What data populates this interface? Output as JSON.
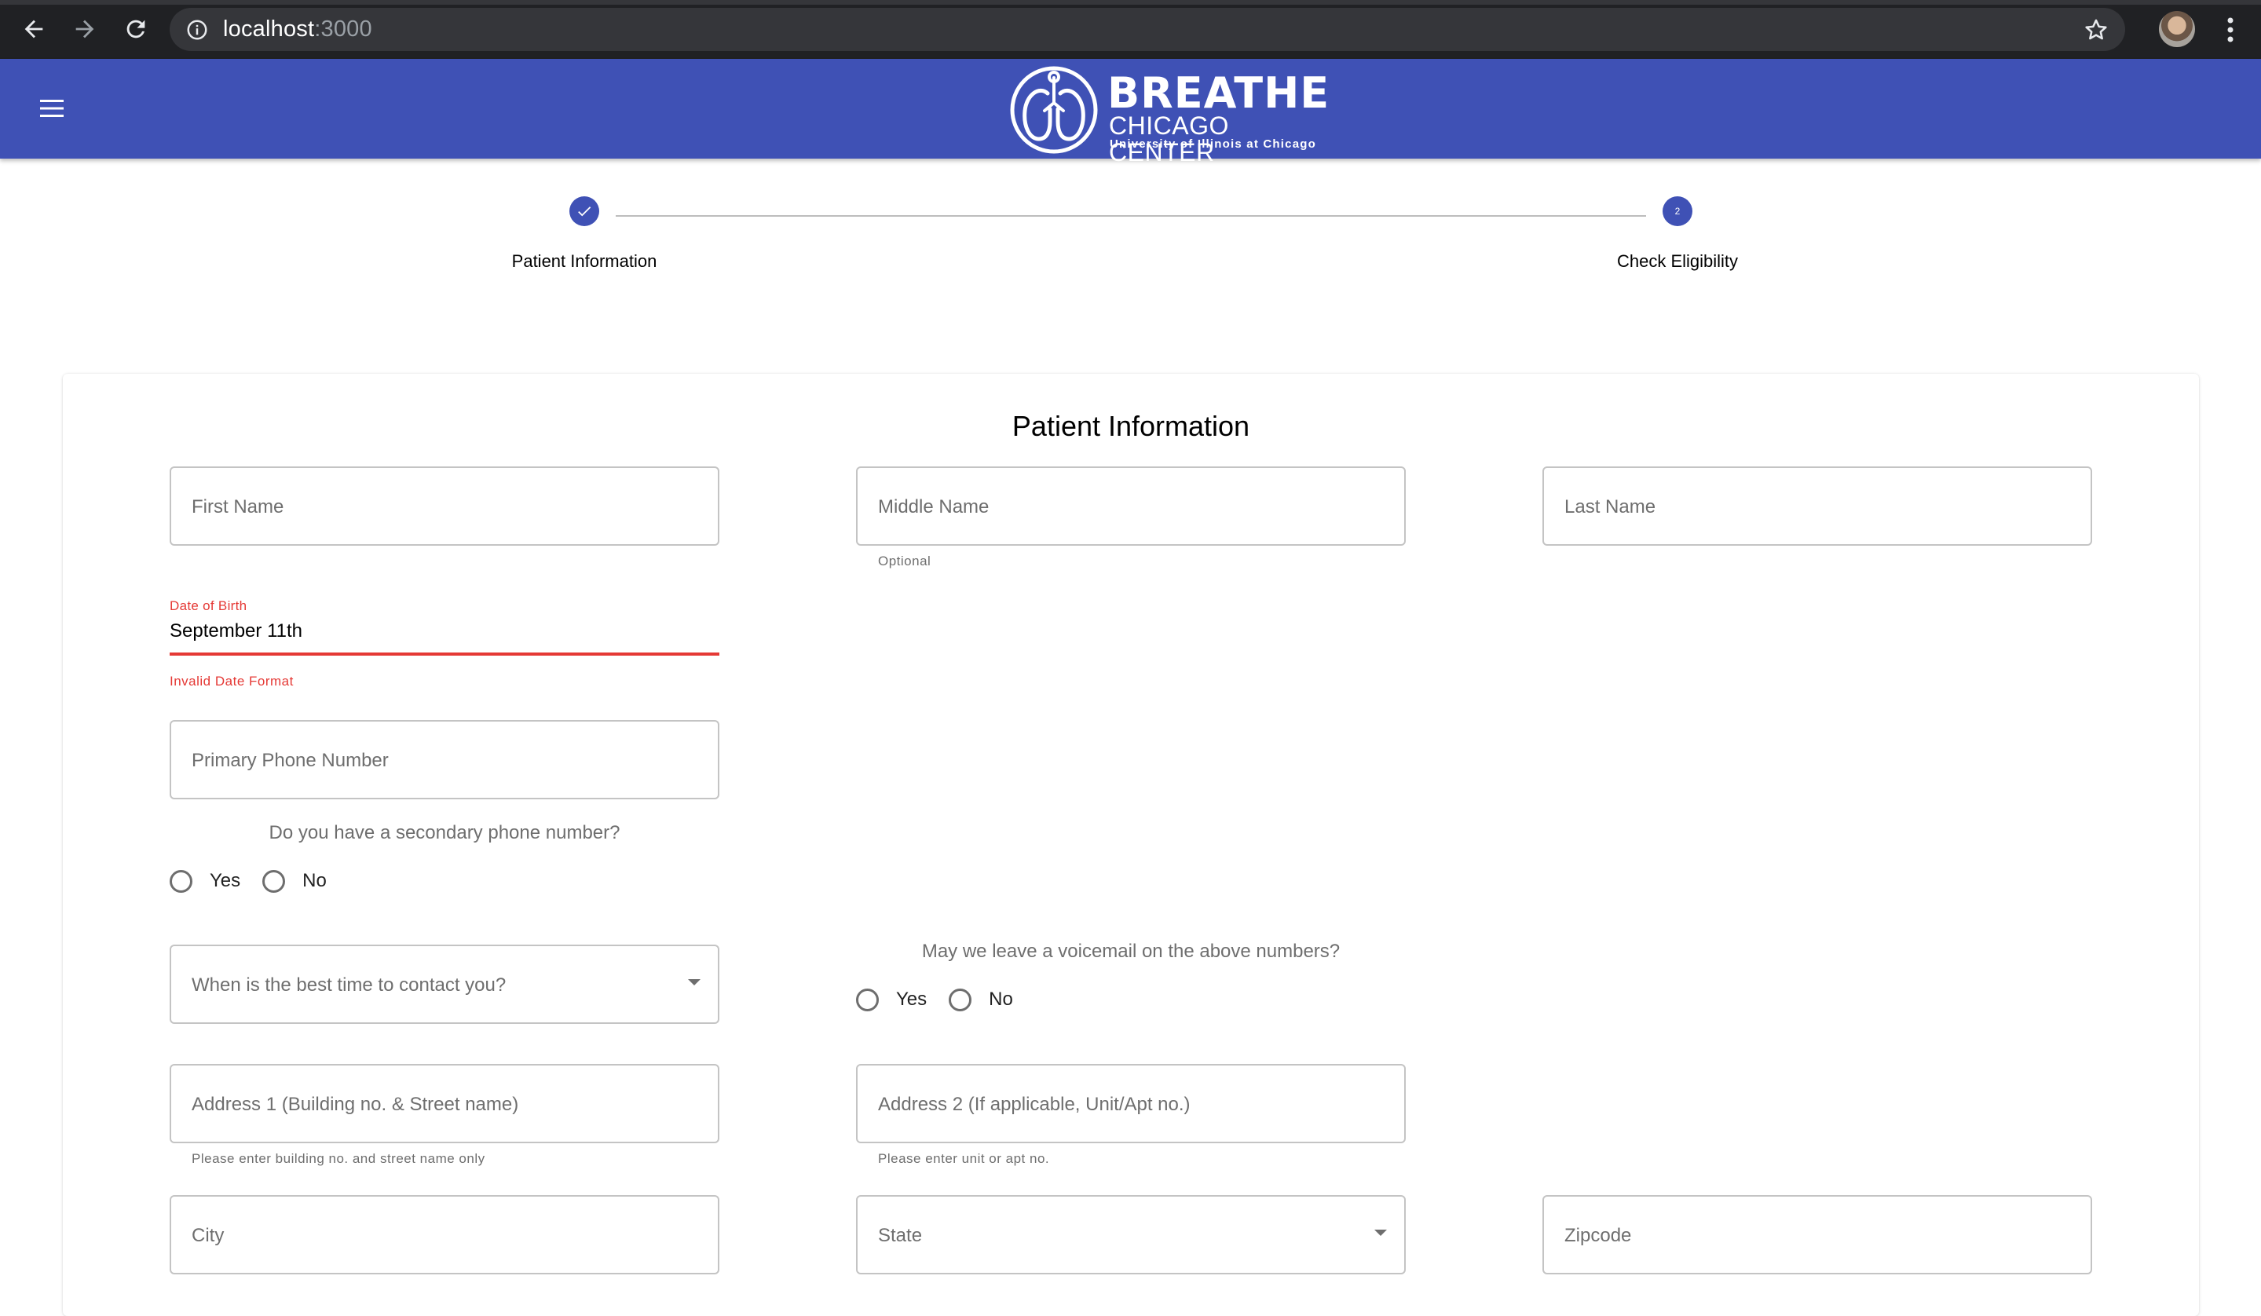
{
  "browser": {
    "url_host": "localhost",
    "url_port": ":3000",
    "icons": {
      "back": "arrow-left-icon",
      "forward": "arrow-right-icon",
      "reload": "reload-icon",
      "info": "info-circle-icon",
      "bookmark": "star-outline-icon",
      "menu": "kebab-menu-icon"
    }
  },
  "appbar": {
    "menu_icon": "hamburger-menu-icon",
    "logo": {
      "line1": "BREATHE",
      "line2": "CHICAGO CENTER",
      "line3": "University of Illinois at Chicago"
    },
    "color": "#3f51b5"
  },
  "stepper": {
    "steps": [
      {
        "label": "Patient Information",
        "state": "completed",
        "icon": "check-icon"
      },
      {
        "label": "Check Eligibility",
        "state": "active",
        "number": "2"
      }
    ]
  },
  "form": {
    "title": "Patient Information",
    "first_name": {
      "placeholder": "First Name"
    },
    "middle_name": {
      "placeholder": "Middle Name",
      "helper": "Optional"
    },
    "last_name": {
      "placeholder": "Last Name"
    },
    "dob": {
      "label": "Date of Birth",
      "value": "September 11th",
      "error": "Invalid Date Format",
      "error_color": "#e53935"
    },
    "primary_phone": {
      "placeholder": "Primary Phone Number"
    },
    "secondary_phone_question": {
      "text": "Do you have a secondary phone number?",
      "options": [
        "Yes",
        "No"
      ]
    },
    "best_time": {
      "placeholder": "When is the best time to contact you?"
    },
    "voicemail_question": {
      "text": "May we leave a voicemail on the above numbers?",
      "options": [
        "Yes",
        "No"
      ]
    },
    "address1": {
      "placeholder": "Address 1 (Building no. & Street name)",
      "helper": "Please enter building no. and street name only"
    },
    "address2": {
      "placeholder": "Address 2 (If applicable, Unit/Apt no.)",
      "helper": "Please enter unit or apt no."
    },
    "city": {
      "placeholder": "City"
    },
    "state": {
      "placeholder": "State"
    },
    "zipcode": {
      "placeholder": "Zipcode"
    }
  }
}
